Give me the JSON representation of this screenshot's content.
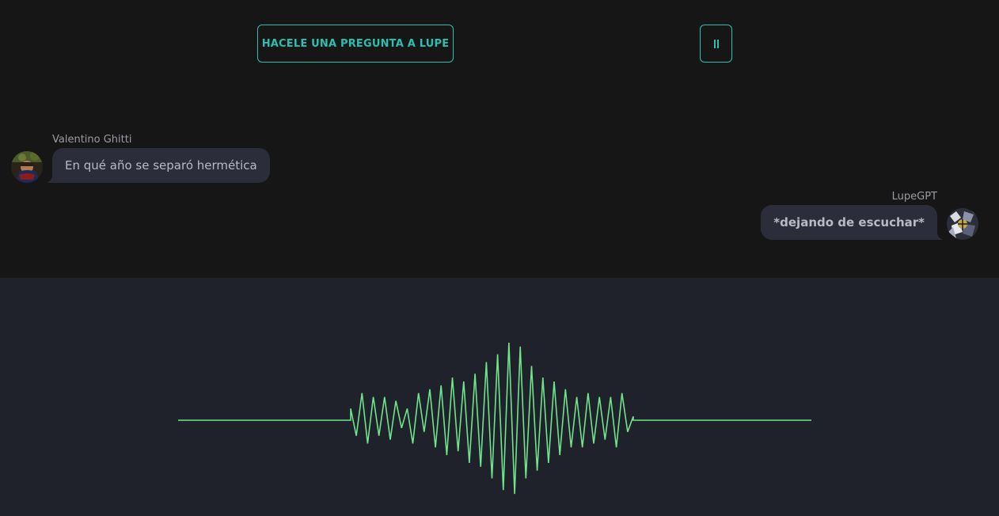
{
  "header": {
    "ask_button_label": "HACELE UNA PREGUNTA A LUPE",
    "pause_button_icon": "pause-icon"
  },
  "messages": [
    {
      "sender": "Valentino Ghitti",
      "text": "En qué año se separó hermética",
      "side": "left",
      "avatar": "user-avatar-photo"
    },
    {
      "sender": "LupeGPT",
      "text": "*dejando de escuchar*",
      "side": "right",
      "avatar": "bot-avatar-illustration"
    }
  ],
  "colors": {
    "chat_background": "#161616",
    "visualizer_background": "#1f222b",
    "accent_teal": "#2bbfb0",
    "waveform_green": "#6fe48a",
    "bubble_background": "#2b2d3a"
  },
  "visualizer": {
    "type": "audio-waveform",
    "samples": [
      0,
      0,
      0,
      0,
      0,
      0,
      0,
      0.15,
      -0.2,
      0.35,
      -0.3,
      0.3,
      -0.2,
      0.3,
      -0.25,
      0.25,
      -0.1,
      0.15,
      -0.3,
      0.35,
      -0.15,
      0.4,
      -0.35,
      0.45,
      -0.45,
      0.55,
      -0.4,
      0.5,
      -0.55,
      0.6,
      -0.6,
      0.75,
      -0.75,
      0.85,
      -0.9,
      1.0,
      -0.95,
      0.95,
      -0.75,
      0.7,
      -0.65,
      0.55,
      -0.55,
      0.5,
      -0.45,
      0.4,
      -0.35,
      0.3,
      -0.35,
      0.35,
      -0.3,
      0.3,
      -0.25,
      0.3,
      -0.35,
      0.35,
      -0.15,
      0.05,
      0,
      0,
      0,
      0,
      0,
      0,
      0,
      0
    ]
  }
}
